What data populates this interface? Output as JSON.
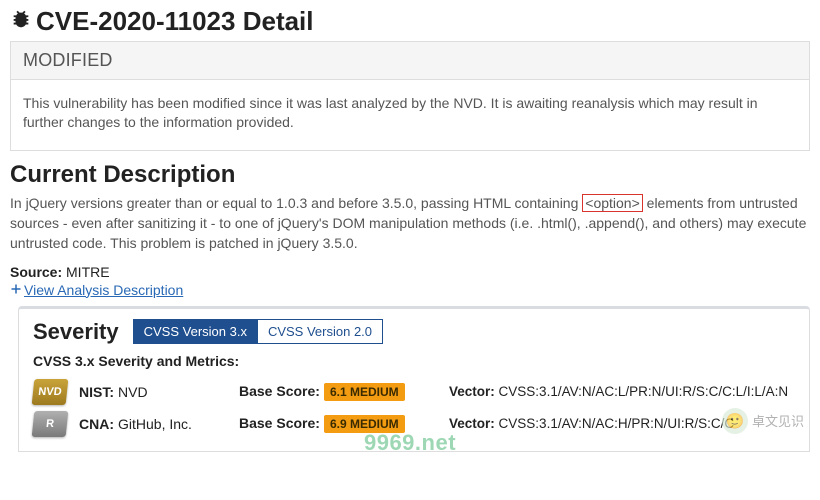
{
  "page": {
    "title": "CVE-2020-11023 Detail"
  },
  "modified": {
    "heading": "MODIFIED",
    "body": "This vulnerability has been modified since it was last analyzed by the NVD. It is awaiting reanalysis which may result in further changes to the information provided."
  },
  "description": {
    "heading": "Current Description",
    "text_before": "In jQuery versions greater than or equal to 1.0.3 and before 3.5.0, passing HTML containing ",
    "highlighted": "<option>",
    "text_after": " elements from untrusted sources - even after sanitizing it - to one of jQuery's DOM manipulation methods (i.e. .html(), .append(), and others) may execute untrusted code. This problem is patched in jQuery 3.5.0.",
    "source_label": "Source:",
    "source_value": "MITRE",
    "expand_link": "View Analysis Description"
  },
  "severity": {
    "heading": "Severity",
    "tabs": {
      "active": "CVSS Version 3.x",
      "inactive": "CVSS Version 2.0"
    },
    "subhead": "CVSS 3.x Severity and Metrics:",
    "rows": [
      {
        "badge_text": "NVD",
        "badge_class": "badge-nvd",
        "authority_label": "NIST:",
        "authority_value": "NVD",
        "score_label": "Base Score:",
        "score_value": "6.1 MEDIUM",
        "vector_label": "Vector:",
        "vector_value": "CVSS:3.1/AV:N/AC:L/PR:N/UI:R/S:C/C:L/I:L/A:N"
      },
      {
        "badge_text": "R",
        "badge_class": "badge-cna",
        "authority_label": "CNA:",
        "authority_value": "GitHub, Inc.",
        "score_label": "Base Score:",
        "score_value": "6.9 MEDIUM",
        "vector_label": "Vector:",
        "vector_value": "CVSS:3.1/AV:N/AC:H/PR:N/UI:R/S:C/C"
      }
    ]
  },
  "watermark": "9969.net",
  "brand_overlay": "卓文见识"
}
